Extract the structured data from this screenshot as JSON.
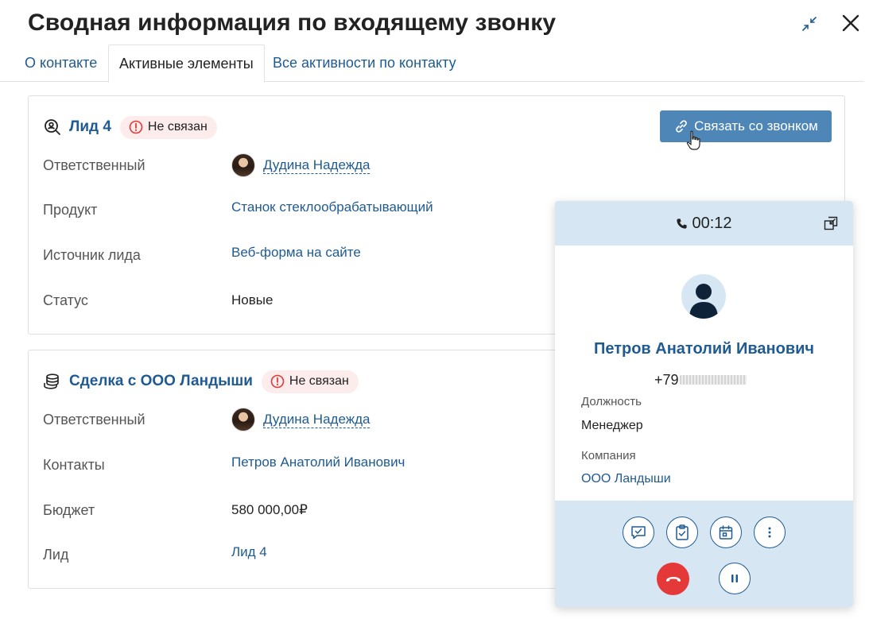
{
  "header": {
    "title": "Сводная информация по входящему звонку"
  },
  "tabs": [
    {
      "label": "О контакте"
    },
    {
      "label": "Активные элементы"
    },
    {
      "label": "Все активности по контакту"
    }
  ],
  "lead_card": {
    "title": "Лид 4",
    "status_badge": "Не связан",
    "link_button": "Связать со звонком",
    "fields": [
      {
        "label": "Ответственный",
        "value": "Дудина Надежда"
      },
      {
        "label": "Продукт",
        "value": "Станок стеклообрабатывающий"
      },
      {
        "label": "Источник лида",
        "value": "Веб-форма на сайте"
      },
      {
        "label": "Статус",
        "value": "Новые"
      }
    ]
  },
  "deal_card": {
    "title": "Сделка с ООО Ландыши",
    "status_badge": "Не связан",
    "fields": [
      {
        "label": "Ответственный",
        "value": "Дудина Надежда"
      },
      {
        "label": "Контакты",
        "value": "Петров Анатолий Иванович"
      },
      {
        "label": "Бюджет",
        "value": "580 000,00₽"
      },
      {
        "label": "Лид",
        "value": "Лид 4"
      }
    ]
  },
  "call_panel": {
    "timer": "00:12",
    "contact_name": "Петров Анатолий Иванович",
    "phone_visible": "+79",
    "position_label": "Должность",
    "position_value": "Менеджер",
    "company_label": "Компания",
    "company_value": "ООО Ландыши",
    "actions": [
      "comment-icon",
      "task-icon",
      "calendar-icon",
      "more-icon"
    ],
    "call_controls": [
      "hangup-icon",
      "pause-icon"
    ]
  },
  "colors": {
    "link": "#1f5b92",
    "button": "#4e86b8",
    "badge_bg": "#fdecec",
    "badge_icon": "#e53939",
    "panel_bg": "#d7e6f3",
    "hangup": "#e53939"
  }
}
